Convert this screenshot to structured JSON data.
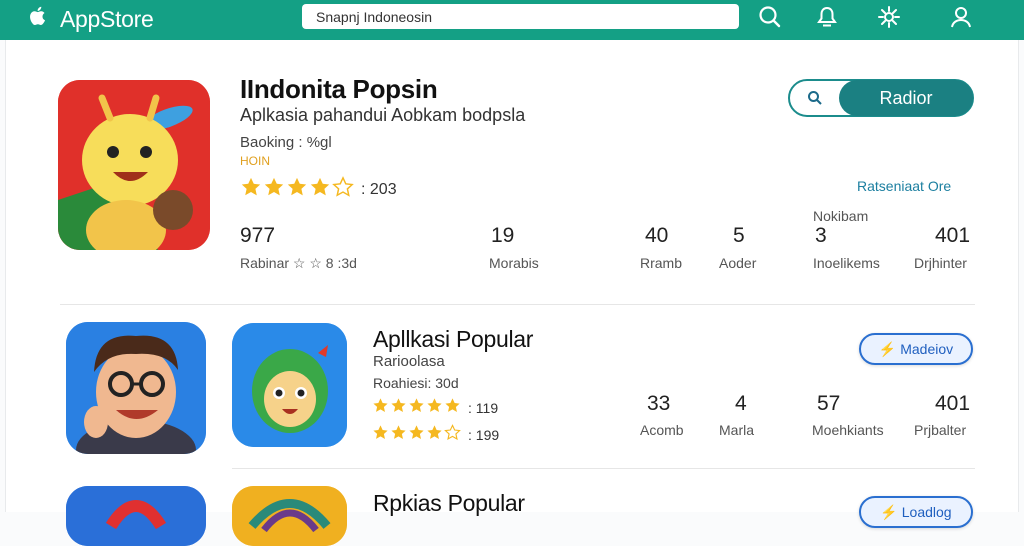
{
  "header": {
    "logo_text": "AppStore",
    "search_placeholder": "Snapnj Indoneosin",
    "accent": "#14a085"
  },
  "featured": {
    "title": "IIndonita Popsin",
    "subtitle": "Aplkasia pahandui Aobkam bodpsla",
    "meta": "Baoking : %gl",
    "tag": "HOIN",
    "rating_count": ": 203",
    "stars": 4,
    "action_button": "Radior",
    "side_link": "Ratseniaat Ore",
    "side_label": "Nokibam",
    "stats": [
      {
        "value": "977",
        "label": "Rabinar ☆ ☆ 8 :3d"
      },
      {
        "value": "19",
        "label": "Morabis"
      },
      {
        "value": "40",
        "label": "Rramb"
      },
      {
        "value": "5",
        "label": "Aoder"
      },
      {
        "value": "3",
        "label": "Inoelikems"
      },
      {
        "value": "401",
        "label": "Drjhinter"
      }
    ]
  },
  "popular1": {
    "title": "Apllkasi Popular",
    "subtitle": "Rarioolasa",
    "meta": "Roahiesi: 30d",
    "rating_a": ": 119",
    "rating_b": ": 199",
    "stars_a": 5,
    "stars_b": 4,
    "button": "Madeiov",
    "stats": [
      {
        "value": "33",
        "label": "Acomb"
      },
      {
        "value": "4",
        "label": "Marla"
      },
      {
        "value": "57",
        "label": "Moehkiants"
      },
      {
        "value": "401",
        "label": "Prjbalter"
      }
    ]
  },
  "popular2": {
    "title": "Rpkias Popular",
    "button": "Loadlog"
  },
  "icons": [
    "apple-logo-icon",
    "search-icon",
    "bell-icon",
    "settings-icon",
    "user-icon",
    "star-icon",
    "chart-icon",
    "bolt-icon"
  ]
}
